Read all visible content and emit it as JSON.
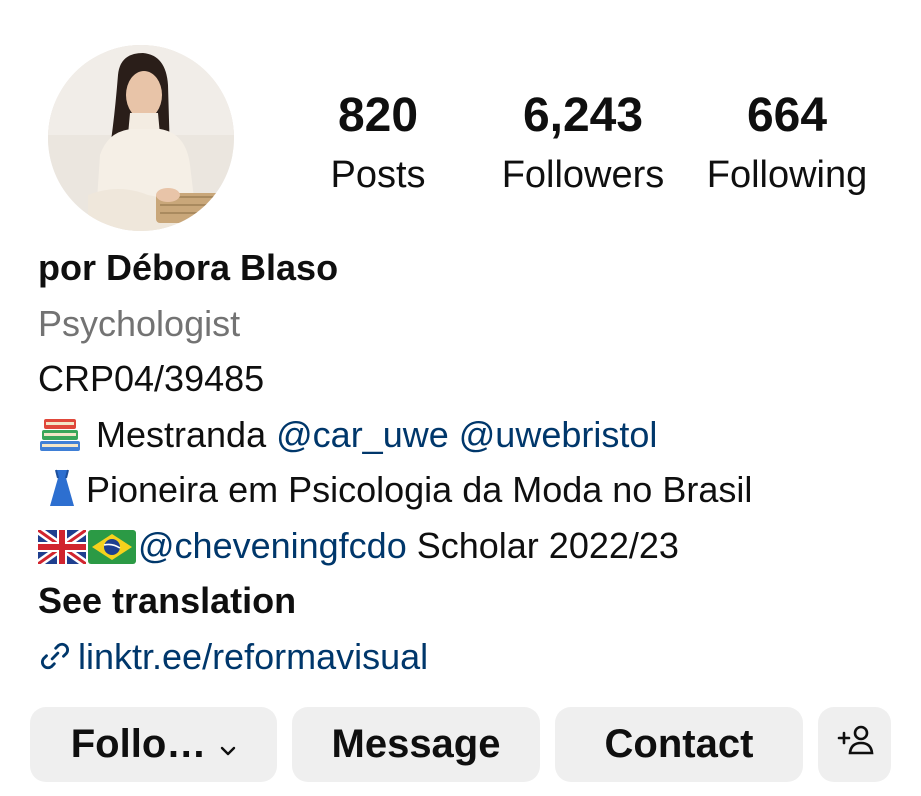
{
  "profile": {
    "avatar_icon": "profile-photo",
    "stats": {
      "posts_count": "820",
      "posts_label": "Posts",
      "followers_count": "6,243",
      "followers_label": "Followers",
      "following_count": "664",
      "following_label": "Following"
    },
    "name": "por Débora Blaso",
    "category": "Psychologist",
    "bio": {
      "line1": "CRP04/39485",
      "line2_text": "Mestranda",
      "line2_mention1": "@car_uwe",
      "line2_mention2": "@uwebristol",
      "line3_text": "Pioneira em Psicologia da Moda no Brasil",
      "line4_mention": "@cheveningfcdo",
      "line4_text": "Scholar 2022/23"
    },
    "see_translation": "See translation",
    "link": "linktr.ee/reformavisual"
  },
  "actions": {
    "following_label": "Follo…",
    "message_label": "Message",
    "contact_label": "Contact",
    "suggest_icon": "add-person-icon"
  },
  "colors": {
    "link": "#00376b",
    "muted": "#737373",
    "button_bg": "#efefef"
  }
}
